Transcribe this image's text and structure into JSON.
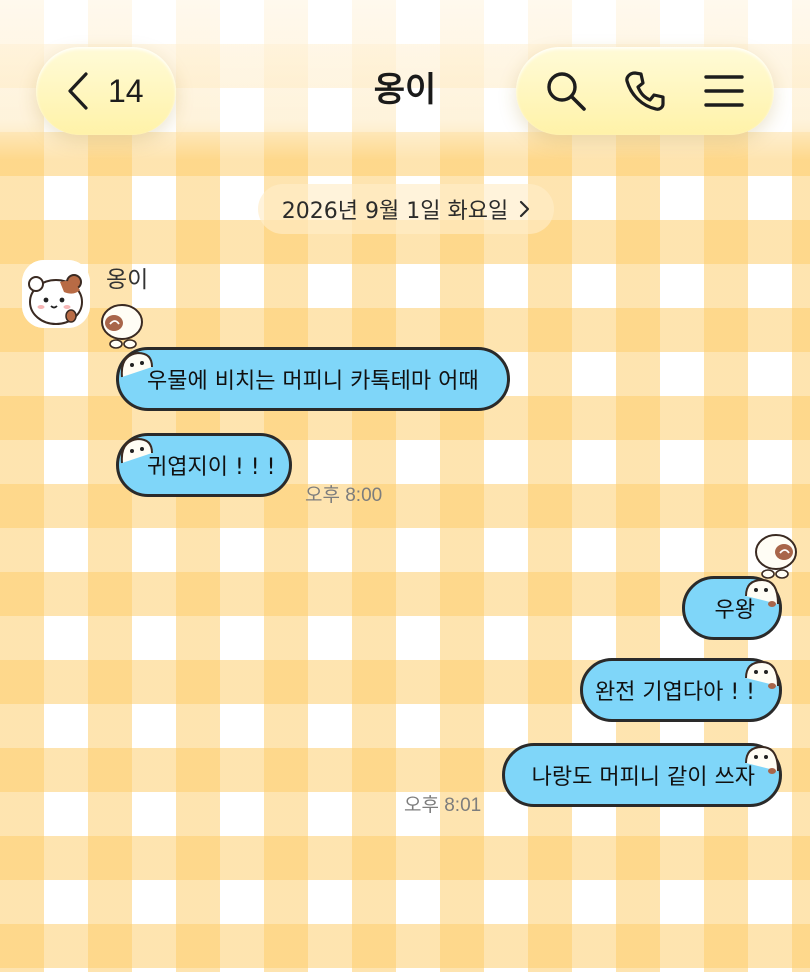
{
  "header": {
    "back_count": "14",
    "title": "옹이",
    "icons": [
      "chevron-left-icon",
      "search-icon",
      "phone-icon",
      "menu-icon"
    ]
  },
  "date_divider": {
    "label": "2026년 9월 1일 화요일"
  },
  "incoming": {
    "sender": "옹이",
    "messages": [
      "우물에 비치는 머피니 카톡테마 어때",
      "귀엽지이 ! ! !"
    ],
    "time": "오후 8:00"
  },
  "outgoing": {
    "messages": [
      "우왕",
      "완전 기엽다아 ! !",
      "나랑도 머피니 같이 쓰자"
    ],
    "time": "오후 8:01"
  },
  "colors": {
    "bubble": "#7fd6f9",
    "bubble_border": "#2a2a2a",
    "check_yellow": "#fdce6e",
    "pill": "#fff2a8"
  }
}
